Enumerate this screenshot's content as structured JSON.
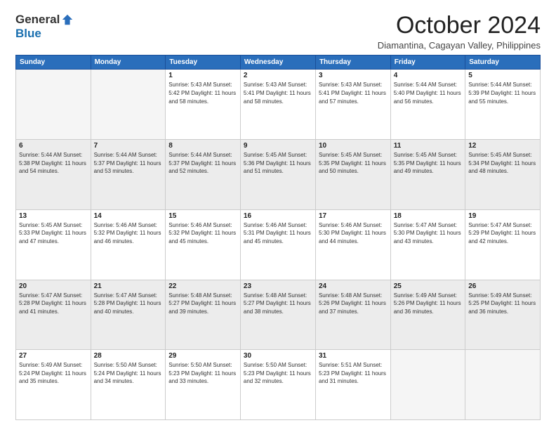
{
  "logo": {
    "general": "General",
    "blue": "Blue"
  },
  "title": "October 2024",
  "subtitle": "Diamantina, Cagayan Valley, Philippines",
  "days_of_week": [
    "Sunday",
    "Monday",
    "Tuesday",
    "Wednesday",
    "Thursday",
    "Friday",
    "Saturday"
  ],
  "weeks": [
    [
      {
        "num": "",
        "info": ""
      },
      {
        "num": "",
        "info": ""
      },
      {
        "num": "1",
        "info": "Sunrise: 5:43 AM\nSunset: 5:42 PM\nDaylight: 11 hours and 58 minutes."
      },
      {
        "num": "2",
        "info": "Sunrise: 5:43 AM\nSunset: 5:41 PM\nDaylight: 11 hours and 58 minutes."
      },
      {
        "num": "3",
        "info": "Sunrise: 5:43 AM\nSunset: 5:41 PM\nDaylight: 11 hours and 57 minutes."
      },
      {
        "num": "4",
        "info": "Sunrise: 5:44 AM\nSunset: 5:40 PM\nDaylight: 11 hours and 56 minutes."
      },
      {
        "num": "5",
        "info": "Sunrise: 5:44 AM\nSunset: 5:39 PM\nDaylight: 11 hours and 55 minutes."
      }
    ],
    [
      {
        "num": "6",
        "info": "Sunrise: 5:44 AM\nSunset: 5:38 PM\nDaylight: 11 hours and 54 minutes."
      },
      {
        "num": "7",
        "info": "Sunrise: 5:44 AM\nSunset: 5:37 PM\nDaylight: 11 hours and 53 minutes."
      },
      {
        "num": "8",
        "info": "Sunrise: 5:44 AM\nSunset: 5:37 PM\nDaylight: 11 hours and 52 minutes."
      },
      {
        "num": "9",
        "info": "Sunrise: 5:45 AM\nSunset: 5:36 PM\nDaylight: 11 hours and 51 minutes."
      },
      {
        "num": "10",
        "info": "Sunrise: 5:45 AM\nSunset: 5:35 PM\nDaylight: 11 hours and 50 minutes."
      },
      {
        "num": "11",
        "info": "Sunrise: 5:45 AM\nSunset: 5:35 PM\nDaylight: 11 hours and 49 minutes."
      },
      {
        "num": "12",
        "info": "Sunrise: 5:45 AM\nSunset: 5:34 PM\nDaylight: 11 hours and 48 minutes."
      }
    ],
    [
      {
        "num": "13",
        "info": "Sunrise: 5:45 AM\nSunset: 5:33 PM\nDaylight: 11 hours and 47 minutes."
      },
      {
        "num": "14",
        "info": "Sunrise: 5:46 AM\nSunset: 5:32 PM\nDaylight: 11 hours and 46 minutes."
      },
      {
        "num": "15",
        "info": "Sunrise: 5:46 AM\nSunset: 5:32 PM\nDaylight: 11 hours and 45 minutes."
      },
      {
        "num": "16",
        "info": "Sunrise: 5:46 AM\nSunset: 5:31 PM\nDaylight: 11 hours and 45 minutes."
      },
      {
        "num": "17",
        "info": "Sunrise: 5:46 AM\nSunset: 5:30 PM\nDaylight: 11 hours and 44 minutes."
      },
      {
        "num": "18",
        "info": "Sunrise: 5:47 AM\nSunset: 5:30 PM\nDaylight: 11 hours and 43 minutes."
      },
      {
        "num": "19",
        "info": "Sunrise: 5:47 AM\nSunset: 5:29 PM\nDaylight: 11 hours and 42 minutes."
      }
    ],
    [
      {
        "num": "20",
        "info": "Sunrise: 5:47 AM\nSunset: 5:28 PM\nDaylight: 11 hours and 41 minutes."
      },
      {
        "num": "21",
        "info": "Sunrise: 5:47 AM\nSunset: 5:28 PM\nDaylight: 11 hours and 40 minutes."
      },
      {
        "num": "22",
        "info": "Sunrise: 5:48 AM\nSunset: 5:27 PM\nDaylight: 11 hours and 39 minutes."
      },
      {
        "num": "23",
        "info": "Sunrise: 5:48 AM\nSunset: 5:27 PM\nDaylight: 11 hours and 38 minutes."
      },
      {
        "num": "24",
        "info": "Sunrise: 5:48 AM\nSunset: 5:26 PM\nDaylight: 11 hours and 37 minutes."
      },
      {
        "num": "25",
        "info": "Sunrise: 5:49 AM\nSunset: 5:26 PM\nDaylight: 11 hours and 36 minutes."
      },
      {
        "num": "26",
        "info": "Sunrise: 5:49 AM\nSunset: 5:25 PM\nDaylight: 11 hours and 36 minutes."
      }
    ],
    [
      {
        "num": "27",
        "info": "Sunrise: 5:49 AM\nSunset: 5:24 PM\nDaylight: 11 hours and 35 minutes."
      },
      {
        "num": "28",
        "info": "Sunrise: 5:50 AM\nSunset: 5:24 PM\nDaylight: 11 hours and 34 minutes."
      },
      {
        "num": "29",
        "info": "Sunrise: 5:50 AM\nSunset: 5:23 PM\nDaylight: 11 hours and 33 minutes."
      },
      {
        "num": "30",
        "info": "Sunrise: 5:50 AM\nSunset: 5:23 PM\nDaylight: 11 hours and 32 minutes."
      },
      {
        "num": "31",
        "info": "Sunrise: 5:51 AM\nSunset: 5:23 PM\nDaylight: 11 hours and 31 minutes."
      },
      {
        "num": "",
        "info": ""
      },
      {
        "num": "",
        "info": ""
      }
    ]
  ]
}
